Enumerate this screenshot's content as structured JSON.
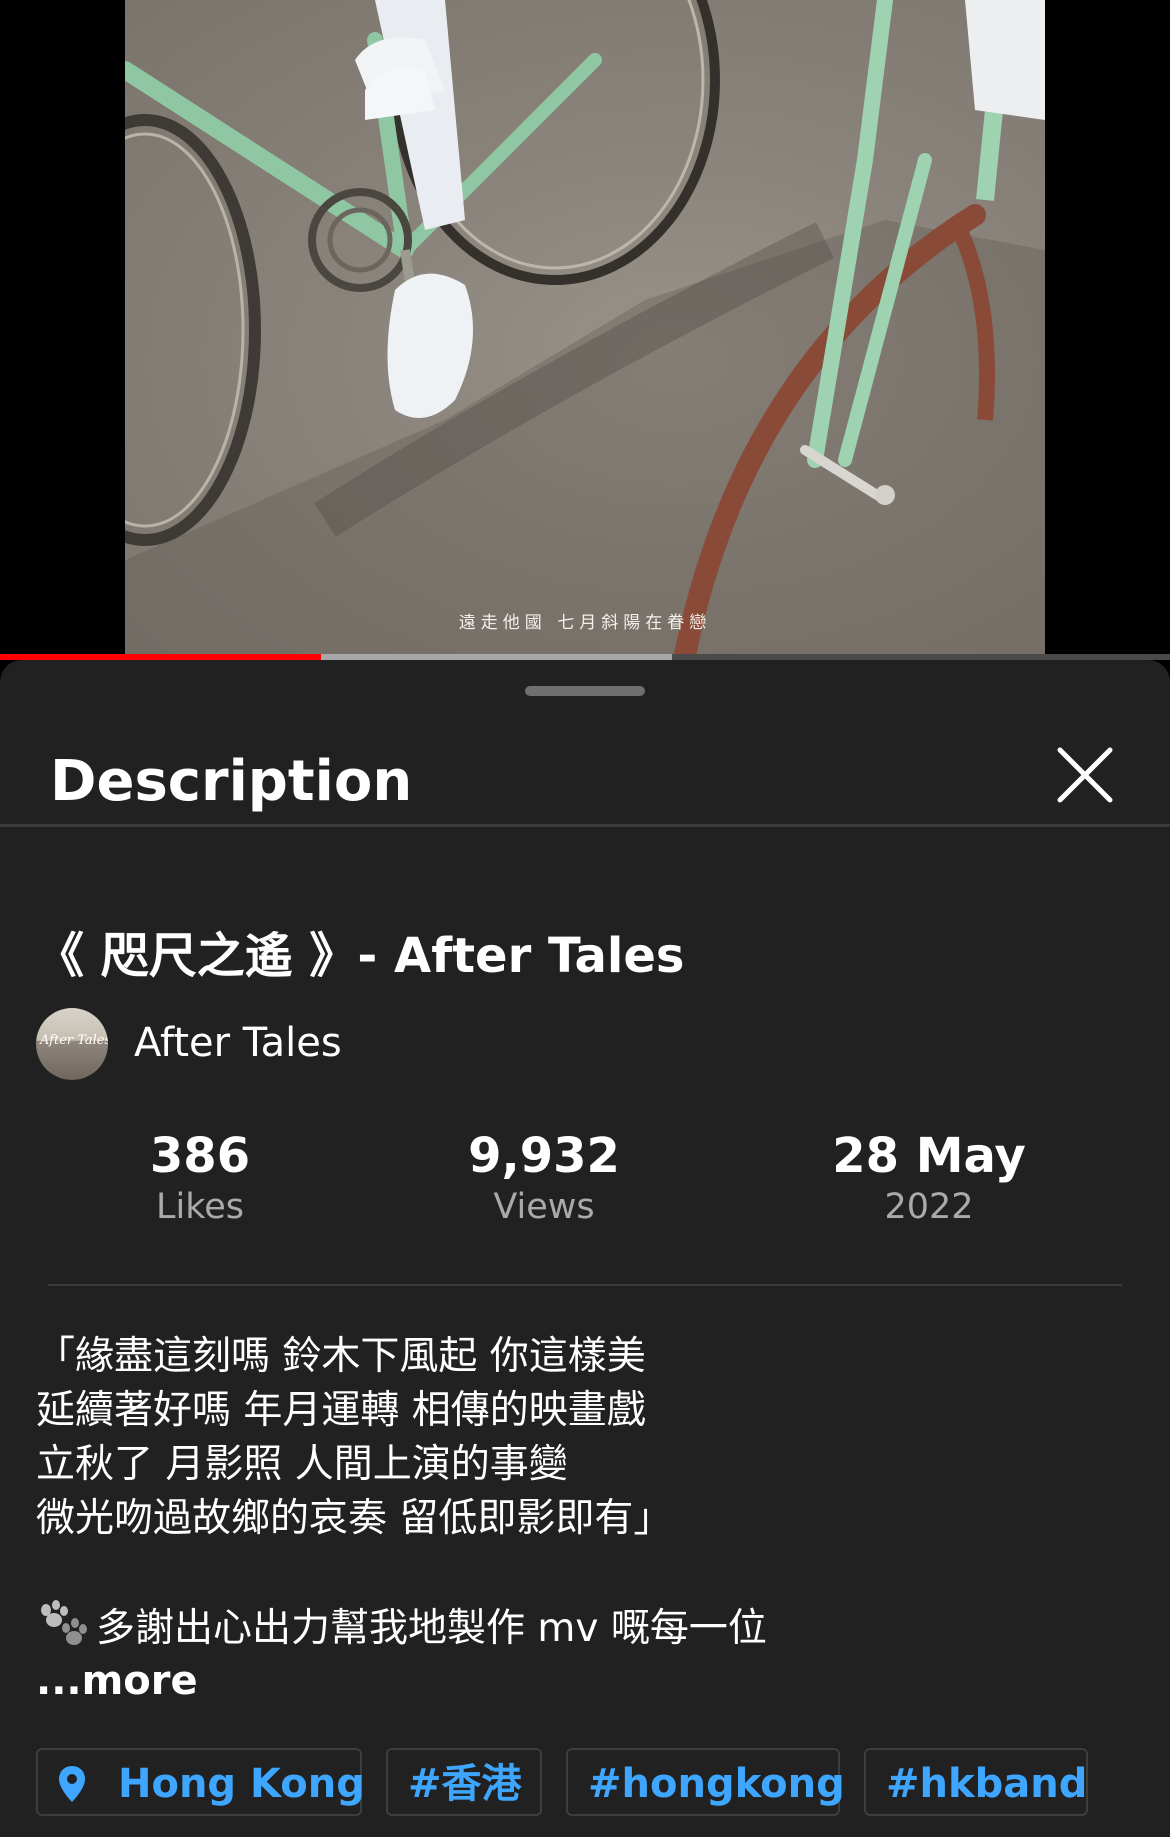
{
  "video": {
    "subtitle": "遠走他國 七月斜陽在眷戀",
    "progress": {
      "played_fraction": 0.274,
      "buffered_fraction": 0.574
    }
  },
  "sheet": {
    "title": "Description",
    "close_icon": "close-icon"
  },
  "video_info": {
    "title": "《 咫尺之遙 》- After Tales",
    "channel_name": "After Tales",
    "avatar_text": "After Tales"
  },
  "stats": {
    "likes": {
      "value": "386",
      "label": "Likes"
    },
    "views": {
      "value": "9,932",
      "label": "Views"
    },
    "date": {
      "value": "28 May",
      "label": "2022"
    }
  },
  "description": {
    "lines": [
      "「緣盡這刻嗎 鈴木下風起 你這樣美",
      "延續著好嗎 年月運轉 相傳的映畫戲",
      "立秋了 月影照 人間上演的事變",
      "微光吻過故鄉的哀奏 留低即影即有」"
    ],
    "credit_icon": "paw-prints-icon",
    "credit_line": "多謝出心出力幫我地製作 mv 嘅每一位",
    "more_label": "...more"
  },
  "chips": [
    {
      "label": "Hong Kong",
      "icon": "location-pin-icon"
    },
    {
      "label": "#香港"
    },
    {
      "label": "#hongkong"
    },
    {
      "label": "#hkband"
    }
  ],
  "colors": {
    "sheet_bg": "#212121",
    "link": "#3ea6ff",
    "progress_played": "#ff0000",
    "secondary_text": "#aaaaaa"
  }
}
